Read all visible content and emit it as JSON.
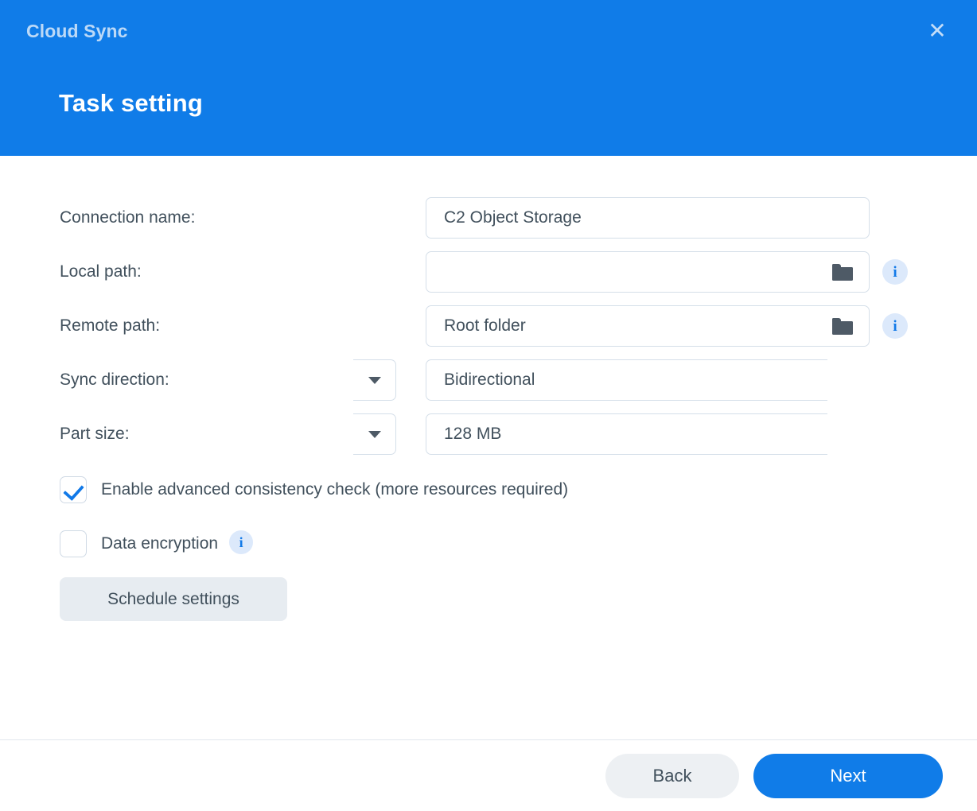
{
  "header": {
    "app_title": "Cloud Sync",
    "page_title": "Task setting",
    "close_label": "✕",
    "bg_color": "#107CE8"
  },
  "form": {
    "connection_name": {
      "label": "Connection name:",
      "value": "C2 Object Storage",
      "placeholder": ""
    },
    "local_path": {
      "label": "Local path:",
      "value": "",
      "placeholder": "",
      "browse_icon": "folder-icon",
      "info_icon": "info-icon"
    },
    "remote_path": {
      "label": "Remote path:",
      "value": "Root folder",
      "placeholder": "",
      "browse_icon": "folder-icon",
      "info_icon": "info-icon"
    },
    "sync_direction": {
      "label": "Sync direction:",
      "value": "Bidirectional",
      "arrow_icon": "chevron-down-icon"
    },
    "part_size": {
      "label": "Part size:",
      "value": "128 MB",
      "arrow_icon": "chevron-down-icon"
    }
  },
  "options": {
    "advanced_consistency": {
      "label": "Enable advanced consistency check (more resources required)",
      "checked": true
    },
    "data_encryption": {
      "label": "Data encryption",
      "checked": false,
      "info_icon": "info-icon",
      "info_glyph": "i"
    }
  },
  "actions": {
    "schedule_settings": "Schedule settings",
    "back": "Back",
    "next": "Next"
  },
  "icons": {
    "info_glyph": "i"
  },
  "colors": {
    "accent": "#107CE8",
    "label_text": "#41505C",
    "field_border": "#D5DFE9",
    "info_bg": "#DCE9FB",
    "button_neutral": "#EDF0F3"
  }
}
